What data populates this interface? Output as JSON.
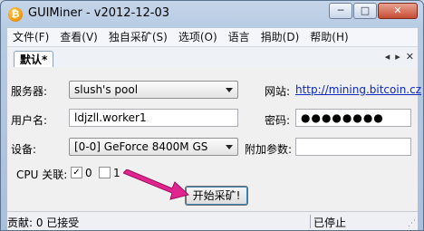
{
  "window": {
    "title": "GUIMiner - v2012-12-03",
    "app_icon_glyph": "₿",
    "controls": [
      "minimize-icon",
      "maximize-icon",
      "close-icon"
    ],
    "minimize_glyph": "─",
    "maximize_glyph": "□",
    "close_glyph": "✕"
  },
  "menu": [
    "文件(F)",
    "查看(V)",
    "独自采矿(S)",
    "选项(O)",
    "语言",
    "捐助(D)",
    "帮助(H)"
  ],
  "tabs": {
    "active_label": "默认*",
    "prev_glyph": "◂",
    "next_glyph": "▸",
    "close_glyph": "✕"
  },
  "form": {
    "server_label": "服务器:",
    "server_value": "slush's pool",
    "website_label": "网站:",
    "website_link": "http://mining.bitcoin.cz",
    "username_label": "用户名:",
    "username_value": "ldjzll.worker1",
    "password_label": "密码:",
    "password_value": "●●●●●●●●",
    "device_label": "设备:",
    "device_value": "[0-0] GeForce 8400M GS",
    "extra_params_label": "附加参数:",
    "extra_params_value": "",
    "cpu_affinity_label": "CPU 关联:",
    "cpu0_label": "0",
    "cpu0_checked": true,
    "cpu1_label": "1",
    "cpu1_checked": false,
    "start_button": "开始采矿!"
  },
  "status": {
    "left": "贡献: 0 已接受",
    "right": "已停止"
  },
  "colors": {
    "link": "#0b28c4",
    "arrow": "#e0258f"
  }
}
